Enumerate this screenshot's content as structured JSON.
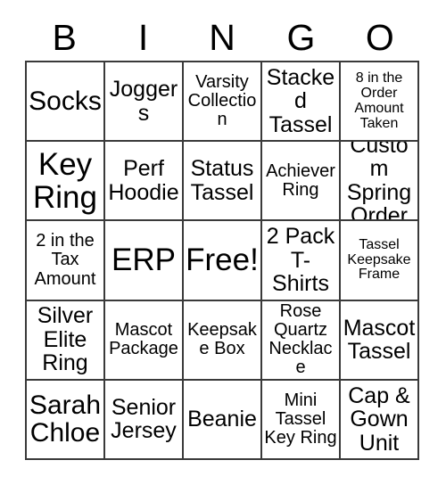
{
  "card": {
    "title": "BINGO",
    "header_letters": [
      "B",
      "I",
      "N",
      "G",
      "O"
    ],
    "border_color": "#3a3a3a",
    "background_color": "#ffffff",
    "text_color": "#000000",
    "rows": 5,
    "columns": 5,
    "cells": [
      [
        {
          "text": "Socks",
          "size": "lg",
          "free": false
        },
        {
          "text": "Joggers",
          "size": "md",
          "free": false
        },
        {
          "text": "Varsity Collection",
          "size": "sm",
          "free": false
        },
        {
          "text": "Stacked Tassel",
          "size": "md",
          "free": false
        },
        {
          "text": "8 in the Order Amount Taken",
          "size": "xs",
          "free": false
        }
      ],
      [
        {
          "text": "Key Ring",
          "size": "xl",
          "free": false
        },
        {
          "text": "Perf Hoodie",
          "size": "md",
          "free": false
        },
        {
          "text": "Status Tassel",
          "size": "md",
          "free": false
        },
        {
          "text": "Achiever Ring",
          "size": "sm",
          "free": false
        },
        {
          "text": "Custom Spring Order",
          "size": "md",
          "free": false
        }
      ],
      [
        {
          "text": "2 in the Tax Amount",
          "size": "sm",
          "free": false
        },
        {
          "text": "ERP",
          "size": "xl",
          "free": false
        },
        {
          "text": "Free!",
          "size": "xl",
          "free": true
        },
        {
          "text": "2 Pack T-Shirts",
          "size": "md",
          "free": false
        },
        {
          "text": "Tassel Keepsake Frame",
          "size": "xs",
          "free": false
        }
      ],
      [
        {
          "text": "Silver Elite Ring",
          "size": "md",
          "free": false
        },
        {
          "text": "Mascot Package",
          "size": "sm",
          "free": false
        },
        {
          "text": "Keepsake Box",
          "size": "sm",
          "free": false
        },
        {
          "text": "Rose Quartz Necklace",
          "size": "sm",
          "free": false
        },
        {
          "text": "Mascot Tassel",
          "size": "md",
          "free": false
        }
      ],
      [
        {
          "text": "Sarah Chloe",
          "size": "lg",
          "free": false
        },
        {
          "text": "Senior Jersey",
          "size": "md",
          "free": false
        },
        {
          "text": "Beanie",
          "size": "md",
          "free": false
        },
        {
          "text": "Mini Tassel Key Ring",
          "size": "sm",
          "free": false
        },
        {
          "text": "Cap & Gown Unit",
          "size": "md",
          "free": false
        }
      ]
    ]
  }
}
